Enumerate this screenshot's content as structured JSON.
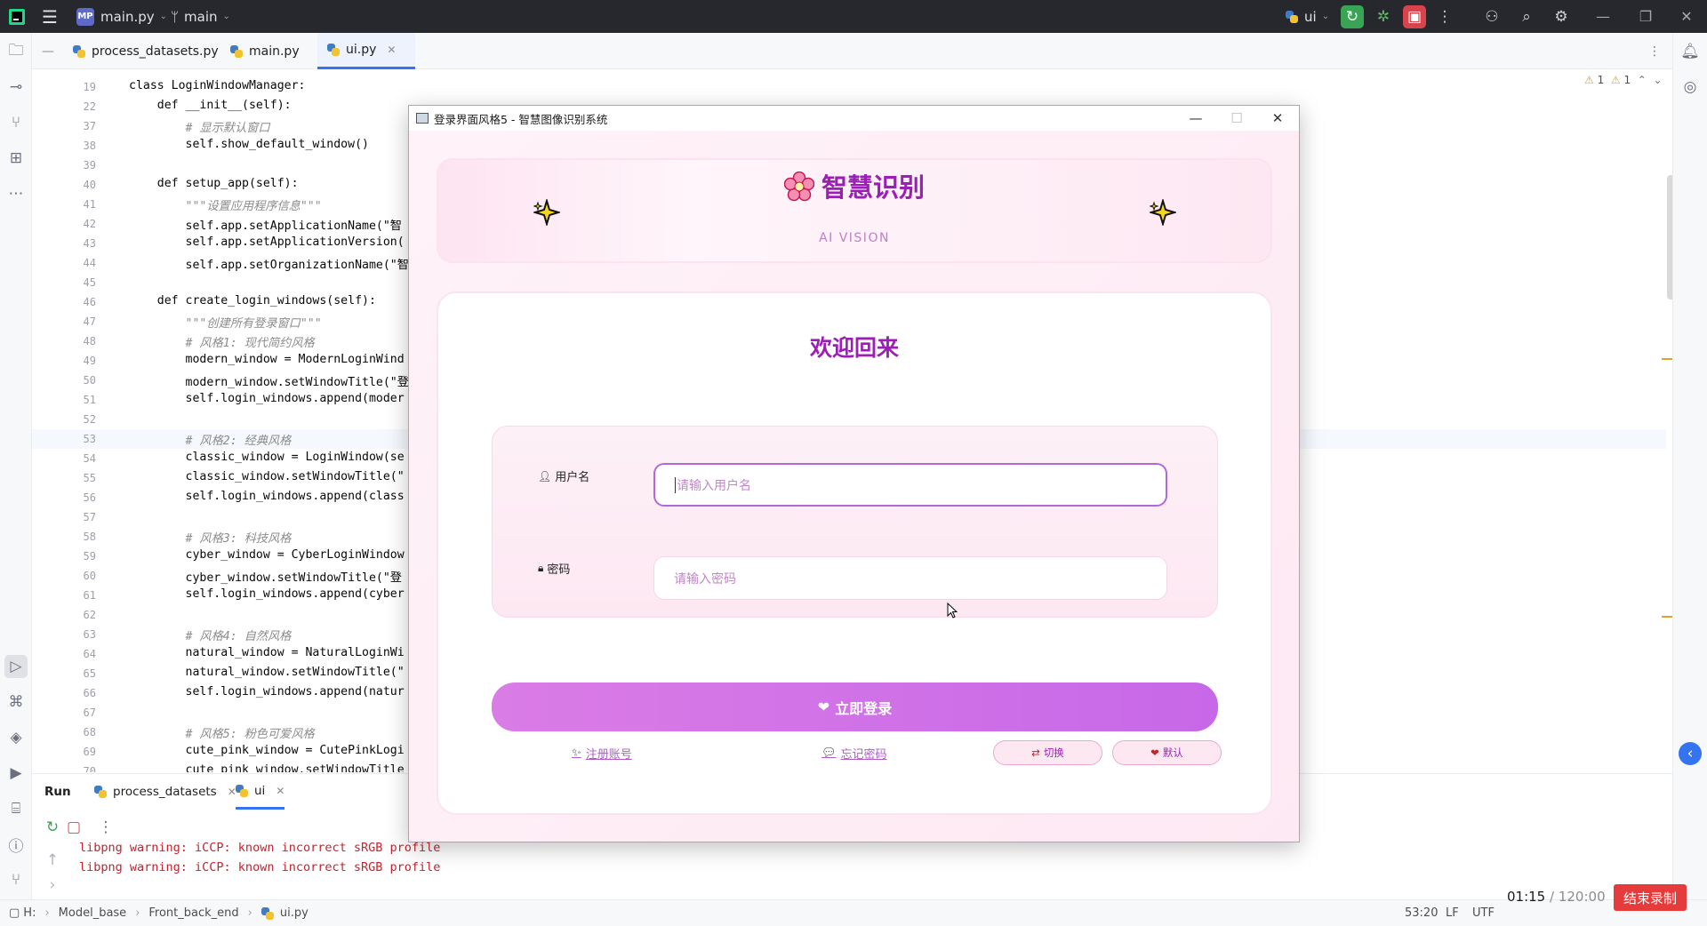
{
  "titlebar": {
    "project_badge": "MP",
    "project_name": "main.py",
    "branch": "main",
    "run_config": "ui"
  },
  "editor_tabs": [
    {
      "label": "process_datasets.py"
    },
    {
      "label": "main.py"
    },
    {
      "label": "ui.py"
    }
  ],
  "editor": {
    "inspections": {
      "warnings": "1",
      "weak_warnings": "1"
    },
    "lines": [
      {
        "num": "19",
        "text": "class LoginWindowManager:"
      },
      {
        "num": "22",
        "text": "    def __init__(self):"
      },
      {
        "num": "37",
        "text": "        # 显示默认窗口"
      },
      {
        "num": "38",
        "text": "        self.show_default_window()"
      },
      {
        "num": "39",
        "text": ""
      },
      {
        "num": "40",
        "text": "    def setup_app(self):"
      },
      {
        "num": "41",
        "text": "        \"\"\"设置应用程序信息\"\"\""
      },
      {
        "num": "42",
        "text": "        self.app.setApplicationName(\"智"
      },
      {
        "num": "43",
        "text": "        self.app.setApplicationVersion("
      },
      {
        "num": "44",
        "text": "        self.app.setOrganizationName(\"智"
      },
      {
        "num": "45",
        "text": ""
      },
      {
        "num": "46",
        "text": "    def create_login_windows(self):"
      },
      {
        "num": "47",
        "text": "        \"\"\"创建所有登录窗口\"\"\""
      },
      {
        "num": "48",
        "text": "        # 风格1: 现代简约风格"
      },
      {
        "num": "49",
        "text": "        modern_window = ModernLoginWind"
      },
      {
        "num": "50",
        "text": "        modern_window.setWindowTitle(\"登"
      },
      {
        "num": "51",
        "text": "        self.login_windows.append(moder"
      },
      {
        "num": "52",
        "text": ""
      },
      {
        "num": "53",
        "text": "        # 风格2: 经典风格"
      },
      {
        "num": "54",
        "text": "        classic_window = LoginWindow(se"
      },
      {
        "num": "55",
        "text": "        classic_window.setWindowTitle(\""
      },
      {
        "num": "56",
        "text": "        self.login_windows.append(class"
      },
      {
        "num": "57",
        "text": ""
      },
      {
        "num": "58",
        "text": "        # 风格3: 科技风格"
      },
      {
        "num": "59",
        "text": "        cyber_window = CyberLoginWindow"
      },
      {
        "num": "60",
        "text": "        cyber_window.setWindowTitle(\"登"
      },
      {
        "num": "61",
        "text": "        self.login_windows.append(cyber"
      },
      {
        "num": "62",
        "text": ""
      },
      {
        "num": "63",
        "text": "        # 风格4: 自然风格"
      },
      {
        "num": "64",
        "text": "        natural_window = NaturalLoginWi"
      },
      {
        "num": "65",
        "text": "        natural_window.setWindowTitle(\""
      },
      {
        "num": "66",
        "text": "        self.login_windows.append(natur"
      },
      {
        "num": "67",
        "text": ""
      },
      {
        "num": "68",
        "text": "        # 风格5: 粉色可爱风格"
      },
      {
        "num": "69",
        "text": "        cute_pink_window = CutePinkLogi"
      },
      {
        "num": "70",
        "text": "        cute_pink_window.setWindowTitle"
      }
    ]
  },
  "run_panel": {
    "title": "Run",
    "tabs": [
      {
        "label": "process_datasets"
      },
      {
        "label": "ui"
      }
    ],
    "console": [
      "libpng warning: iCCP: known incorrect sRGB profile",
      "libpng warning: iCCP: known incorrect sRGB profile"
    ]
  },
  "statusbar": {
    "crumbs": [
      "H:",
      "Model_base",
      "Front_back_end",
      "ui.py"
    ],
    "position": "53:20",
    "line_sep": "LF",
    "encoding": "UTF"
  },
  "recording": {
    "elapsed": "01:15",
    "total": "/ 120:00",
    "stop_label": "结束录制"
  },
  "login_window": {
    "title": "登录界面风格5 - 智慧图像识别系统",
    "brand": "智慧识别",
    "subbrand": "AI VISION",
    "welcome": "欢迎回来",
    "username_label": "用户名",
    "username_placeholder": "请输入用户名",
    "password_label": "密码",
    "password_placeholder": "请输入密码",
    "login_button": "立即登录",
    "register_link": "注册账号",
    "forgot_link": "忘记密码",
    "switch_button": "切换",
    "default_button": "默认"
  },
  "colors": {
    "accent": "#9b1fb7",
    "button_gradient_start": "#da7ce6",
    "button_gradient_end": "#c768e8",
    "recording_red": "#e53b3b"
  }
}
